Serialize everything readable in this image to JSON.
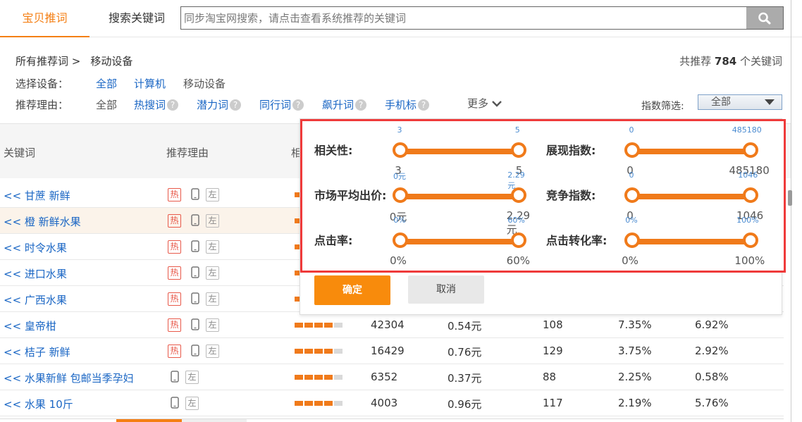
{
  "tabs": [
    {
      "label": "宝贝推词",
      "active": true
    },
    {
      "label": "搜索关键词",
      "active": false
    }
  ],
  "search": {
    "placeholder": "同步淘宝网搜索，请点击查看系统推荐的关键词",
    "icon": "search-icon"
  },
  "breadcrumb": {
    "root": "所有推荐词 >",
    "current": "移动设备"
  },
  "total": {
    "prefix": "共推荐",
    "count": "784",
    "suffix": "个关键词"
  },
  "device": {
    "label": "选择设备：",
    "options": [
      "全部",
      "计算机",
      "移动设备"
    ]
  },
  "reason": {
    "label": "推荐理由：",
    "options": [
      "全部",
      "热搜词",
      "潜力词",
      "同行词",
      "飙升词",
      "手机标"
    ],
    "more": "更多"
  },
  "index_filter": {
    "label": "指数筛选:",
    "value": "全部"
  },
  "table": {
    "headers": [
      "关键词",
      "推荐理由",
      "相"
    ],
    "rows": [
      {
        "keyword": "<< 甘蔗 新鲜",
        "hot": true,
        "bars": 4,
        "c1": "",
        "c2": "",
        "c3": "",
        "c4": "",
        "c5": ""
      },
      {
        "keyword": "<< 橙 新鲜水果",
        "hot": true,
        "bars": 4,
        "c1": "",
        "c2": "",
        "c3": "",
        "c4": "",
        "c5": ""
      },
      {
        "keyword": "<< 时令水果",
        "hot": true,
        "bars": 4,
        "c1": "",
        "c2": "",
        "c3": "",
        "c4": "",
        "c5": ""
      },
      {
        "keyword": "<< 进口水果",
        "hot": true,
        "bars": 4,
        "c1": "",
        "c2": "",
        "c3": "",
        "c4": "",
        "c5": ""
      },
      {
        "keyword": "<< 广西水果",
        "hot": true,
        "bars": 4,
        "c1": "",
        "c2": "",
        "c3": "",
        "c4": "",
        "c5": ""
      },
      {
        "keyword": "<< 皇帝柑",
        "hot": true,
        "bars": 4,
        "c1": "42304",
        "c2": "0.54元",
        "c3": "108",
        "c4": "7.35%",
        "c5": "6.92%"
      },
      {
        "keyword": "<< 桔子 新鲜",
        "hot": true,
        "bars": 4,
        "c1": "16429",
        "c2": "0.76元",
        "c3": "129",
        "c4": "3.75%",
        "c5": "2.92%"
      },
      {
        "keyword": "<< 水果新鲜 包邮当季孕妇",
        "hot": false,
        "bars": 4,
        "c1": "6352",
        "c2": "0.37元",
        "c3": "88",
        "c4": "2.25%",
        "c5": "0.58%"
      },
      {
        "keyword": "<< 水果 10斤",
        "hot": false,
        "bars": 4,
        "c1": "4003",
        "c2": "0.96元",
        "c3": "117",
        "c4": "2.19%",
        "c5": "5.76%"
      }
    ],
    "tag_hot": "热",
    "tag_left": "左"
  },
  "filter_popup": {
    "sliders": [
      {
        "label": "相关性:",
        "min_top": "3",
        "max_top": "5",
        "min": "3",
        "max": "5"
      },
      {
        "label": "展现指数:",
        "min_top": "0",
        "max_top": "485180",
        "min": "0",
        "max": "485180"
      },
      {
        "label": "市场平均出价:",
        "min_top": "0元",
        "max_top": "2.29元",
        "min": "0元",
        "max": "2.29元"
      },
      {
        "label": "竞争指数:",
        "min_top": "0",
        "max_top": "1046",
        "min": "0",
        "max": "1046"
      },
      {
        "label": "点击率:",
        "min_top": "0%",
        "max_top": "60%",
        "min": "0%",
        "max": "60%"
      },
      {
        "label": "点击转化率:",
        "min_top": "0%",
        "max_top": "100%",
        "min": "0%",
        "max": "100%"
      }
    ],
    "confirm": "确定",
    "cancel": "取消",
    "colors": {
      "accent": "#f07a1a",
      "highlight_border": "#ef3a3a",
      "confirm_bg": "#f88b0c"
    }
  }
}
